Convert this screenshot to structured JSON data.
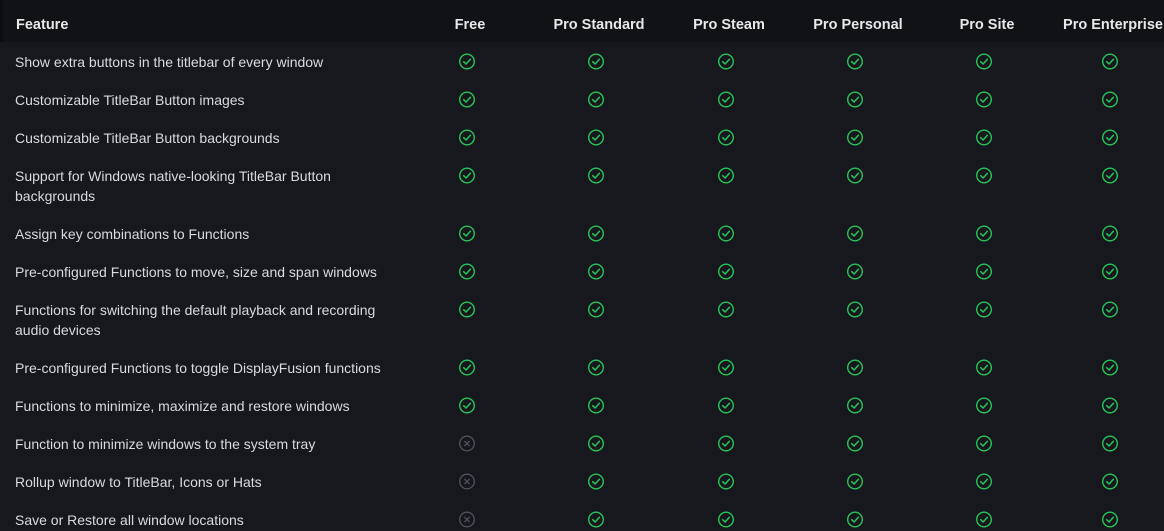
{
  "colors": {
    "background": "#16181d",
    "header_background": "#101216",
    "check": "#29c45a",
    "cross": "#50545a",
    "text": "#d8dadd"
  },
  "header": {
    "feature": "Feature",
    "columns": [
      "Free",
      "Pro Standard",
      "Pro Steam",
      "Pro Personal",
      "Pro Site",
      "Pro Enterprise"
    ]
  },
  "rows": [
    {
      "feature": "Show extra buttons in the titlebar of every window",
      "availability": [
        true,
        true,
        true,
        true,
        true,
        true
      ]
    },
    {
      "feature": "Customizable TitleBar Button images",
      "availability": [
        true,
        true,
        true,
        true,
        true,
        true
      ]
    },
    {
      "feature": "Customizable TitleBar Button backgrounds",
      "availability": [
        true,
        true,
        true,
        true,
        true,
        true
      ]
    },
    {
      "feature": "Support for Windows native-looking TitleBar Button backgrounds",
      "availability": [
        true,
        true,
        true,
        true,
        true,
        true
      ]
    },
    {
      "feature": "Assign key combinations to Functions",
      "availability": [
        true,
        true,
        true,
        true,
        true,
        true
      ]
    },
    {
      "feature": "Pre-configured Functions to move, size and span windows",
      "availability": [
        true,
        true,
        true,
        true,
        true,
        true
      ]
    },
    {
      "feature": "Functions for switching the default playback and recording audio devices",
      "availability": [
        true,
        true,
        true,
        true,
        true,
        true
      ]
    },
    {
      "feature": "Pre-configured Functions to toggle DisplayFusion functions",
      "availability": [
        true,
        true,
        true,
        true,
        true,
        true
      ]
    },
    {
      "feature": "Functions to minimize, maximize and restore windows",
      "availability": [
        true,
        true,
        true,
        true,
        true,
        true
      ]
    },
    {
      "feature": "Function to minimize windows to the system tray",
      "availability": [
        false,
        true,
        true,
        true,
        true,
        true
      ]
    },
    {
      "feature": "Rollup window to TitleBar, Icons or Hats",
      "availability": [
        false,
        true,
        true,
        true,
        true,
        true
      ]
    },
    {
      "feature": "Save or Restore all window locations",
      "availability": [
        false,
        true,
        true,
        true,
        true,
        true
      ]
    }
  ]
}
